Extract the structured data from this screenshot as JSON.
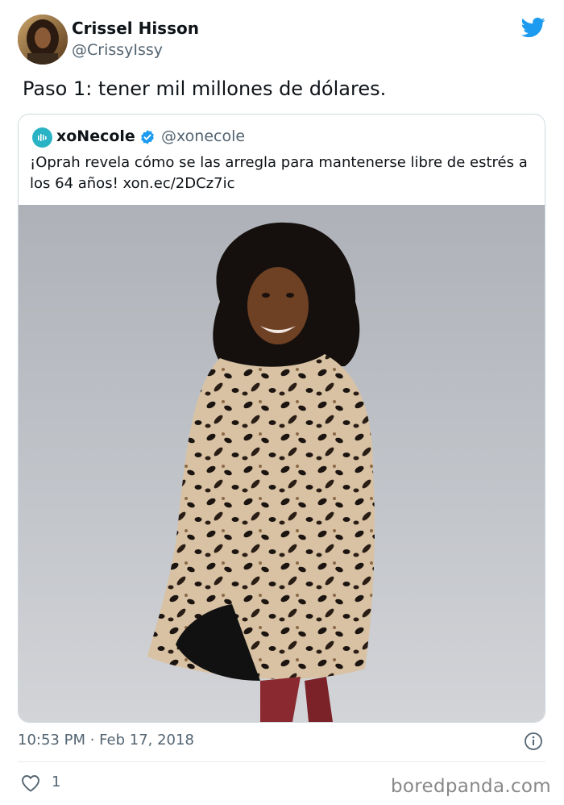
{
  "author": {
    "name": "Crissel Hisson",
    "handle": "@CrissyIssy"
  },
  "tweet": {
    "text": "Paso 1: tener mil millones de dólares."
  },
  "quote": {
    "name": "xoNecole",
    "handle": "@xonecole",
    "verified": true,
    "text": "¡Oprah revela cómo se las arregla para mantenerse libre de estrés a los 64 años! xon.ec/2DCz7ic"
  },
  "footer": {
    "timestamp": "10:53 PM · Feb 17, 2018",
    "likes": "1"
  },
  "watermark": "boredpanda.com",
  "colors": {
    "twitter_blue": "#1d9bf0",
    "verified_blue": "#1d9bf0",
    "secondary_text": "#536471",
    "border": "#cfd9de"
  },
  "icons": {
    "brand": "twitter-bird-icon",
    "verified": "verified-badge-icon",
    "info": "info-icon",
    "like": "heart-icon"
  }
}
